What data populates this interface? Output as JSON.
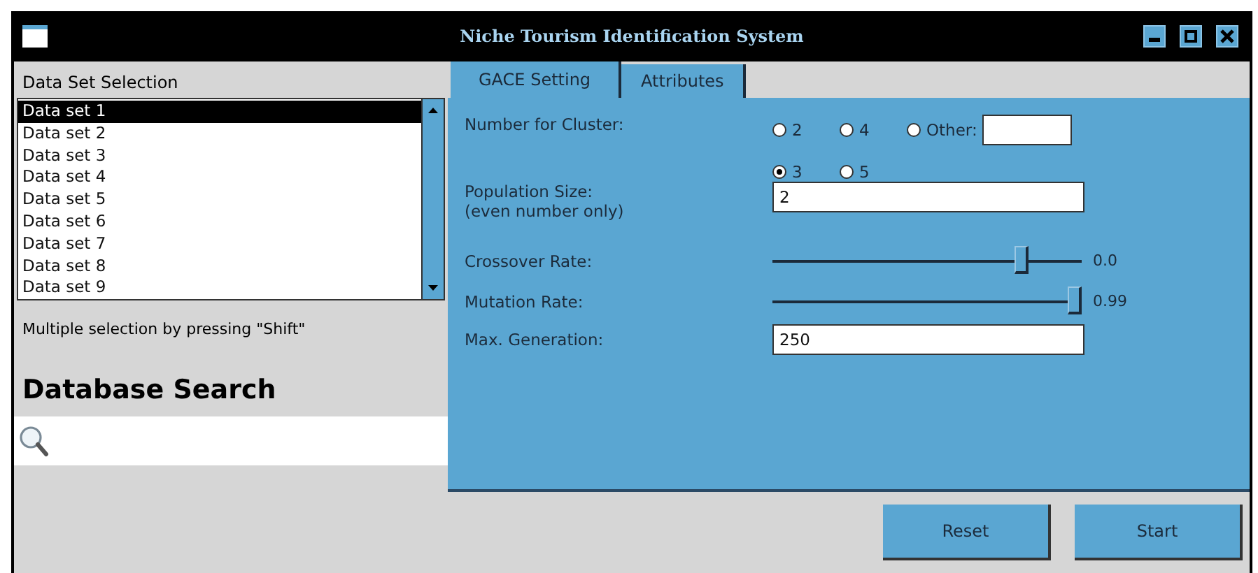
{
  "window": {
    "title": "Niche Tourism Identification System"
  },
  "data_set_selection": {
    "heading": "Data Set Selection",
    "items": [
      {
        "label": "Data set 1",
        "selected": true
      },
      {
        "label": "Data set 2",
        "selected": false
      },
      {
        "label": "Data set 3",
        "selected": false
      },
      {
        "label": "Data set 4",
        "selected": false
      },
      {
        "label": "Data set 5",
        "selected": false
      },
      {
        "label": "Data set 6",
        "selected": false
      },
      {
        "label": "Data set 7",
        "selected": false
      },
      {
        "label": "Data set 8",
        "selected": false
      },
      {
        "label": "Data set 9",
        "selected": false
      }
    ],
    "hint": "Multiple selection by pressing \"Shift\""
  },
  "database_search": {
    "heading": "Database Search"
  },
  "tabs": [
    {
      "label": "GACE Setting",
      "selected": true
    },
    {
      "label": "Attributes",
      "selected": false
    }
  ],
  "settings": {
    "cluster": {
      "label": "Number for Cluster:",
      "options": [
        {
          "label": "2",
          "selected": false,
          "kind": "plain"
        },
        {
          "label": "4",
          "selected": false,
          "kind": "plain"
        },
        {
          "label": "Other:",
          "selected": false,
          "kind": "other"
        },
        {
          "label": "3",
          "selected": true,
          "kind": "plain"
        },
        {
          "label": "5",
          "selected": false,
          "kind": "plain"
        }
      ]
    },
    "population": {
      "label": "Population Size:",
      "sublabel": "(even number only)",
      "value": "2"
    },
    "crossover": {
      "label": "Crossover Rate:",
      "level": 0.82,
      "reading": "0.0"
    },
    "mutation": {
      "label": "Mutation Rate:",
      "level": 1,
      "reading": "0.99"
    },
    "max_generation": {
      "label": "Max. Generation:",
      "value": "250"
    }
  },
  "buttons": [
    "Reset",
    "Start"
  ]
}
